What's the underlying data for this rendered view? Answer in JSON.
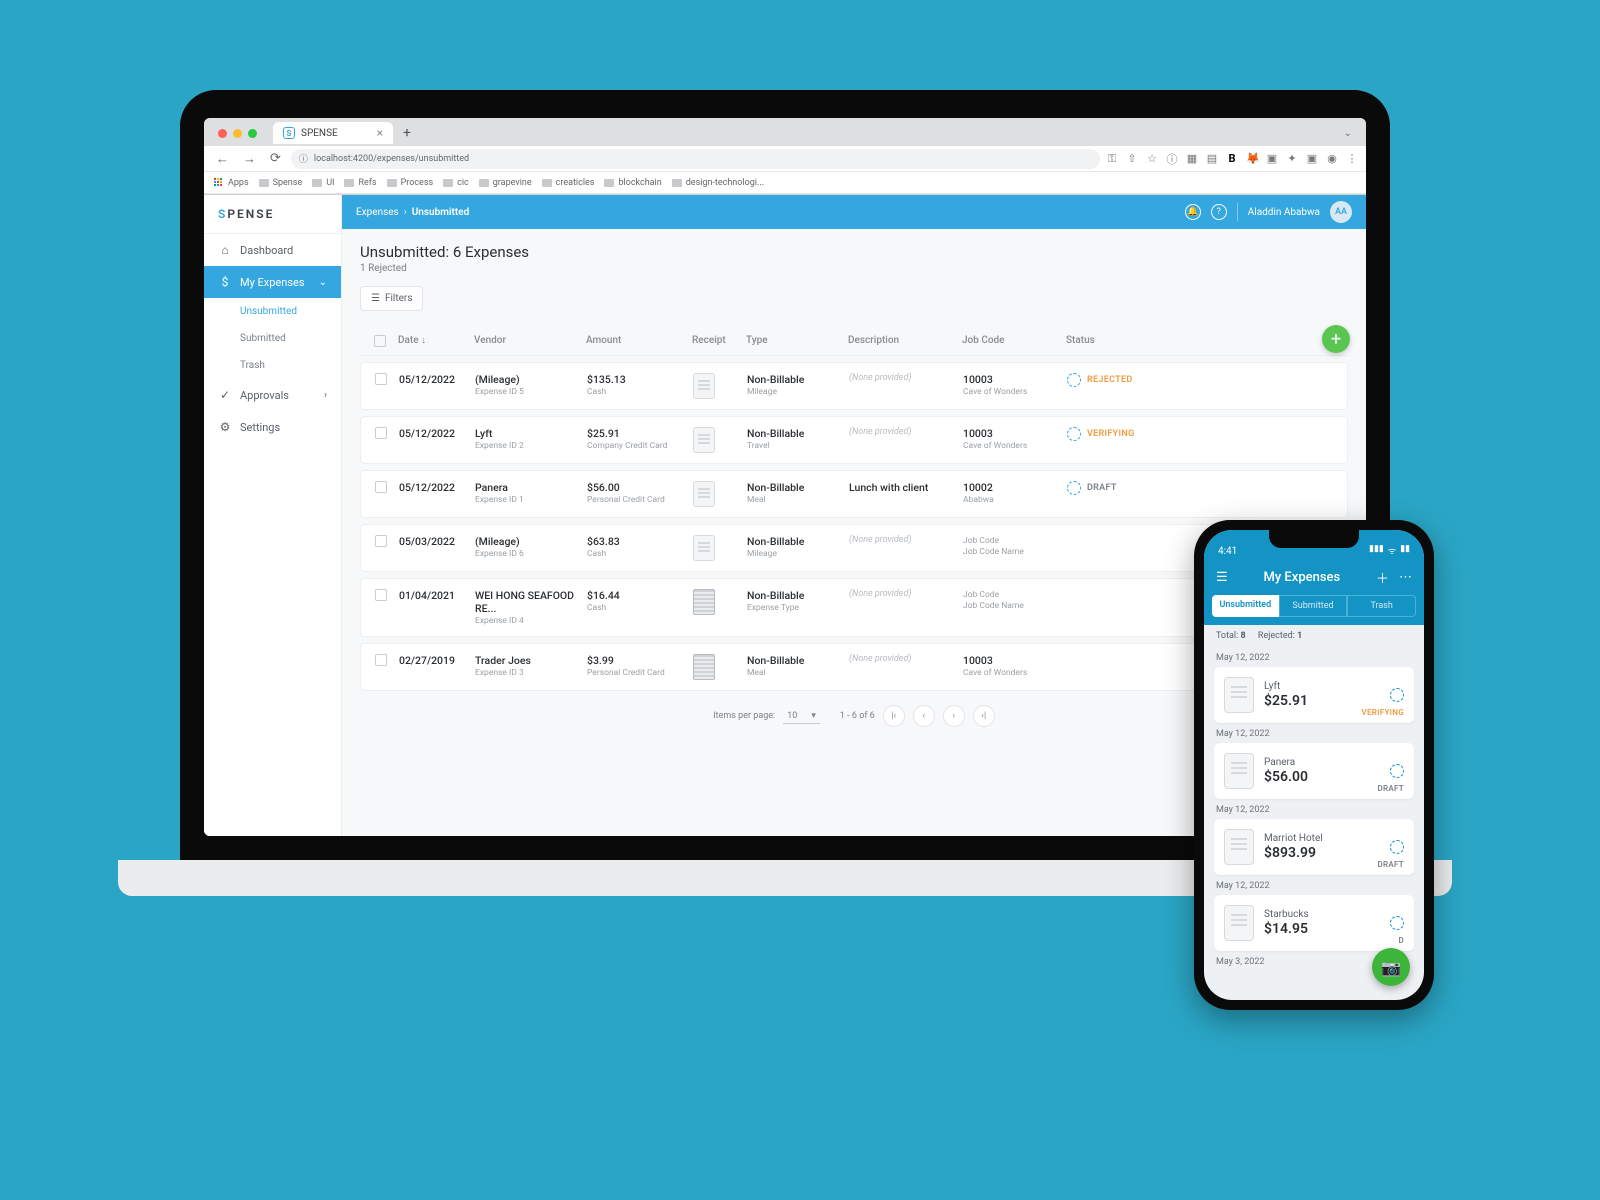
{
  "browser": {
    "tab_title": "SPENSE",
    "url": "localhost:4200/expenses/unsubmitted",
    "bookmarks": [
      "Apps",
      "Spense",
      "UI",
      "Refs",
      "Process",
      "cic",
      "grapevine",
      "creaticles",
      "blockchain",
      "design-technologi..."
    ]
  },
  "sidebar": {
    "logo_prefix": "S",
    "logo_suffix": "PENSE",
    "items": [
      {
        "label": "Dashboard",
        "icon": "⌂"
      },
      {
        "label": "My Expenses",
        "icon": "$",
        "active": true
      },
      {
        "label": "Approvals",
        "icon": "✓"
      },
      {
        "label": "Settings",
        "icon": "⚙"
      }
    ],
    "sub_items": [
      {
        "label": "Unsubmitted",
        "active": true
      },
      {
        "label": "Submitted"
      },
      {
        "label": "Trash"
      }
    ]
  },
  "topbar": {
    "crumb1": "Expenses",
    "crumb2": "Unsubmitted",
    "user_name": "Aladdin Ababwa",
    "user_initials": "AA"
  },
  "page": {
    "title": "Unsubmitted: 6 Expenses",
    "subtitle": "1 Rejected",
    "filters_label": "Filters"
  },
  "table": {
    "headers": {
      "date": "Date",
      "vendor": "Vendor",
      "amount": "Amount",
      "receipt": "Receipt",
      "type": "Type",
      "description": "Description",
      "jobcode": "Job Code",
      "status": "Status"
    },
    "rows": [
      {
        "date": "05/12/2022",
        "vendor": "(Mileage)",
        "vendor_sub": "Expense ID 5",
        "amount": "$135.13",
        "amount_sub": "Cash",
        "receipt": "placeholder",
        "type": "Non-Billable",
        "type_sub": "Mileage",
        "description": "(None provided)",
        "jobcode": "10003",
        "jobcode_sub": "Cave of Wonders",
        "status": "REJECTED",
        "status_class": "rejected"
      },
      {
        "date": "05/12/2022",
        "vendor": "Lyft",
        "vendor_sub": "Expense ID 2",
        "amount": "$25.91",
        "amount_sub": "Company Credit Card",
        "receipt": "placeholder",
        "type": "Non-Billable",
        "type_sub": "Travel",
        "description": "(None provided)",
        "jobcode": "10003",
        "jobcode_sub": "Cave of Wonders",
        "status": "VERIFYING",
        "status_class": "verifying"
      },
      {
        "date": "05/12/2022",
        "vendor": "Panera",
        "vendor_sub": "Expense ID 1",
        "amount": "$56.00",
        "amount_sub": "Personal Credit Card",
        "receipt": "placeholder",
        "type": "Non-Billable",
        "type_sub": "Meal",
        "description": "Lunch with client",
        "jobcode": "10002",
        "jobcode_sub": "Ababwa",
        "status": "DRAFT",
        "status_class": "draft"
      },
      {
        "date": "05/03/2022",
        "vendor": "(Mileage)",
        "vendor_sub": "Expense ID 6",
        "amount": "$63.83",
        "amount_sub": "Cash",
        "receipt": "placeholder",
        "type": "Non-Billable",
        "type_sub": "Mileage",
        "description": "(None provided)",
        "jobcode": "Job Code",
        "jobcode_sub": "Job Code Name",
        "jobcode_muted": true,
        "status": "",
        "status_class": ""
      },
      {
        "date": "01/04/2021",
        "vendor": "WEI HONG SEAFOOD RE...",
        "vendor_sub": "Expense ID 4",
        "amount": "$16.44",
        "amount_sub": "Cash",
        "receipt": "image",
        "type": "Non-Billable",
        "type_sub": "Expense Type",
        "description": "(None provided)",
        "jobcode": "Job Code",
        "jobcode_sub": "Job Code Name",
        "jobcode_muted": true,
        "status": "",
        "status_class": ""
      },
      {
        "date": "02/27/2019",
        "vendor": "Trader Joes",
        "vendor_sub": "Expense ID 3",
        "amount": "$3.99",
        "amount_sub": "Personal Credit Card",
        "receipt": "image",
        "type": "Non-Billable",
        "type_sub": "Meal",
        "description": "(None provided)",
        "jobcode": "10003",
        "jobcode_sub": "Cave of Wonders",
        "status": "",
        "status_class": ""
      }
    ]
  },
  "pager": {
    "items_label": "Items per page:",
    "items_value": "10",
    "range_text": "1 - 6 of 6"
  },
  "phone": {
    "time": "4:41",
    "header_title": "My Expenses",
    "tabs": [
      "Unsubmitted",
      "Submitted",
      "Trash"
    ],
    "summary_total_label": "Total:",
    "summary_total_value": "8",
    "summary_rej_label": "Rejected:",
    "summary_rej_value": "1",
    "groups": [
      {
        "date": "May 12, 2022",
        "cards": [
          {
            "vendor": "Lyft",
            "amount": "$25.91",
            "status": "VERIFYING",
            "status_class": "verifying"
          }
        ]
      },
      {
        "date": "May 12, 2022",
        "cards": [
          {
            "vendor": "Panera",
            "amount": "$56.00",
            "status": "DRAFT",
            "status_class": "draft"
          }
        ]
      },
      {
        "date": "May 12, 2022",
        "cards": [
          {
            "vendor": "Marriot Hotel",
            "amount": "$893.99",
            "status": "DRAFT",
            "status_class": "draft"
          }
        ]
      },
      {
        "date": "May 12, 2022",
        "cards": [
          {
            "vendor": "Starbucks",
            "amount": "$14.95",
            "status": "D",
            "status_class": "draft"
          }
        ]
      },
      {
        "date": "May 3, 2022",
        "cards": []
      }
    ]
  }
}
